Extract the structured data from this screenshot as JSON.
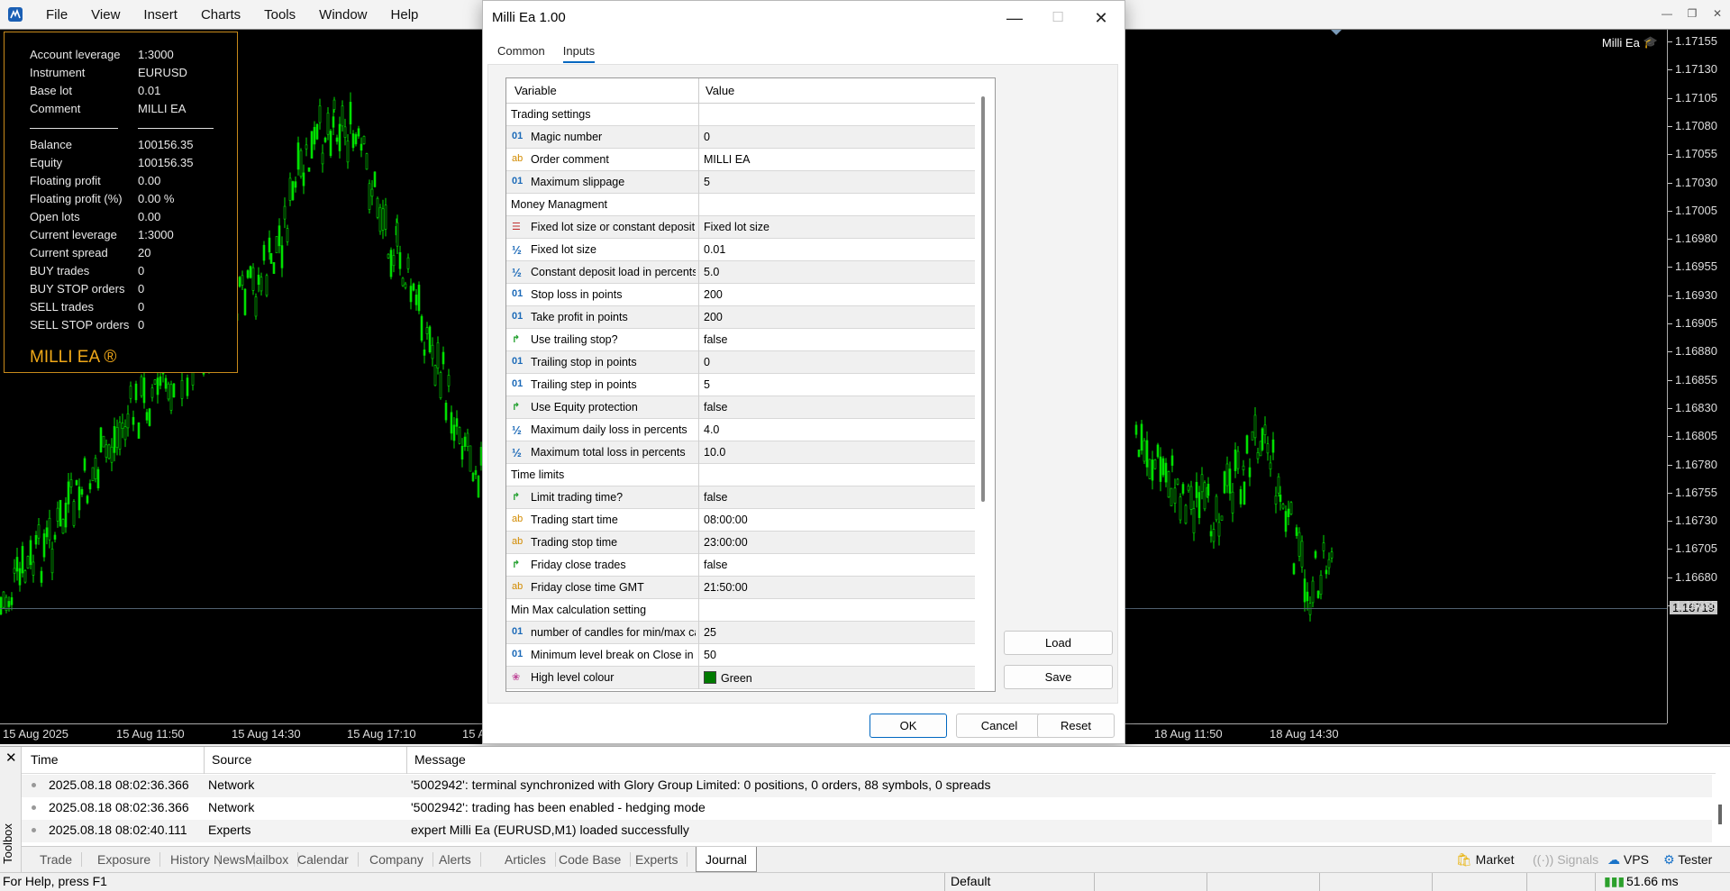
{
  "menubar": {
    "items": [
      "File",
      "View",
      "Insert",
      "Charts",
      "Tools",
      "Window",
      "Help"
    ]
  },
  "chart": {
    "label": "Milli Ea",
    "price_ticks": [
      "1.17155",
      "1.17130",
      "1.17105",
      "1.17080",
      "1.17055",
      "1.17030",
      "1.17005",
      "1.16980",
      "1.16955",
      "1.16930",
      "1.16905",
      "1.16880",
      "1.16855",
      "1.16830",
      "1.16805",
      "1.16780",
      "1.16755",
      "1.16730",
      "1.16705",
      "1.16680",
      "1.16655"
    ],
    "current_price": "1.16719",
    "time_ticks": [
      "15 Aug 2025",
      "15 Aug 11:50",
      "15 Aug 14:30",
      "15 Aug 17:10",
      "15 A",
      "18 Aug 11:50",
      "18 Aug 14:30"
    ],
    "candle_color": "#00e000"
  },
  "infopanel": {
    "rows1": [
      {
        "k": "Account leverage",
        "v": "1:3000"
      },
      {
        "k": "Instrument",
        "v": "EURUSD"
      },
      {
        "k": "Base lot",
        "v": "0.01"
      },
      {
        "k": "Comment",
        "v": "MILLI EA"
      }
    ],
    "rows2": [
      {
        "k": "Balance",
        "v": "100156.35"
      },
      {
        "k": "Equity",
        "v": "100156.35"
      },
      {
        "k": "Floating profit",
        "v": "0.00"
      },
      {
        "k": "Floating profit (%)",
        "v": "0.00 %"
      },
      {
        "k": "Open lots",
        "v": "0.00"
      },
      {
        "k": "Current leverage",
        "v": "1:3000"
      },
      {
        "k": "Current spread",
        "v": "20"
      },
      {
        "k": "BUY trades",
        "v": "0"
      },
      {
        "k": "BUY STOP orders",
        "v": "0"
      },
      {
        "k": "SELL trades",
        "v": "0"
      },
      {
        "k": "SELL STOP orders",
        "v": "0"
      }
    ],
    "brand": "MILLI EA ®"
  },
  "dialog": {
    "title": "Milli Ea 1.00",
    "tabs": [
      "Common",
      "Inputs"
    ],
    "active_tab": "Inputs",
    "col_variable": "Variable",
    "col_value": "Value",
    "rows": [
      {
        "type": "section",
        "var": "Trading settings",
        "val": ""
      },
      {
        "type": "int",
        "var": "Magic number",
        "val": "0"
      },
      {
        "type": "str",
        "var": "Order comment",
        "val": "MILLI EA"
      },
      {
        "type": "int",
        "var": "Maximum slippage",
        "val": "5"
      },
      {
        "type": "section",
        "var": "Money Managment",
        "val": ""
      },
      {
        "type": "enum",
        "var": "Fixed lot size or constant deposit load?",
        "val": "Fixed lot size"
      },
      {
        "type": "dbl",
        "var": "Fixed lot size",
        "val": "0.01"
      },
      {
        "type": "dbl",
        "var": "Constant deposit load in percents",
        "val": "5.0"
      },
      {
        "type": "int",
        "var": "Stop loss in points",
        "val": "200"
      },
      {
        "type": "int",
        "var": "Take profit in points",
        "val": "200"
      },
      {
        "type": "bool",
        "var": "Use trailing stop?",
        "val": "false"
      },
      {
        "type": "int",
        "var": "Trailing stop in points",
        "val": "0"
      },
      {
        "type": "int",
        "var": "Trailing step in points",
        "val": "5"
      },
      {
        "type": "bool",
        "var": "Use Equity protection",
        "val": "false"
      },
      {
        "type": "dbl",
        "var": "Maximum daily loss in percents",
        "val": "4.0"
      },
      {
        "type": "dbl",
        "var": "Maximum total loss in percents",
        "val": "10.0"
      },
      {
        "type": "section",
        "var": "Time limits",
        "val": ""
      },
      {
        "type": "bool",
        "var": "Limit trading time?",
        "val": "false"
      },
      {
        "type": "str",
        "var": "Trading start time",
        "val": "08:00:00"
      },
      {
        "type": "str",
        "var": "Trading stop time",
        "val": "23:00:00"
      },
      {
        "type": "bool",
        "var": "Friday close trades",
        "val": "false"
      },
      {
        "type": "str",
        "var": "Friday close time GMT",
        "val": "21:50:00"
      },
      {
        "type": "section",
        "var": "Min Max calculation setting",
        "val": ""
      },
      {
        "type": "int",
        "var": "number of candles for min/max calcu...",
        "val": "25"
      },
      {
        "type": "int",
        "var": "Minimum level break on Close in points",
        "val": "50"
      },
      {
        "type": "col",
        "var": "High level colour",
        "val": "Green"
      }
    ],
    "icons": {
      "int": "01",
      "str": "ab",
      "dbl": "½",
      "bool": "↱",
      "enum": "☰",
      "col": "❀"
    },
    "buttons": {
      "load": "Load",
      "save": "Save",
      "ok": "OK",
      "cancel": "Cancel",
      "reset": "Reset"
    }
  },
  "toolbox": {
    "side_label": "Toolbox",
    "headers": {
      "time": "Time",
      "source": "Source",
      "message": "Message"
    },
    "log": [
      {
        "time": "2025.08.18 08:02:36.366",
        "source": "Network",
        "message": "'5002942': terminal synchronized with Glory Group Limited: 0 positions, 0 orders, 88 symbols, 0 spreads"
      },
      {
        "time": "2025.08.18 08:02:36.366",
        "source": "Network",
        "message": "'5002942': trading has been enabled - hedging mode"
      },
      {
        "time": "2025.08.18 08:02:40.111",
        "source": "Experts",
        "message": "expert Milli Ea (EURUSD,M1) loaded successfully"
      }
    ],
    "tabs": [
      "Trade",
      "Exposure",
      "History",
      "News",
      "Mailbox",
      "Calendar",
      "Company",
      "Alerts",
      "Articles",
      "Code Base",
      "Experts",
      "Journal"
    ],
    "active_tab": "Journal",
    "right": {
      "market": "Market",
      "signals": "Signals",
      "vps": "VPS",
      "tester": "Tester"
    }
  },
  "statusbar": {
    "help": "For Help, press F1",
    "profile": "Default",
    "ping": "51.66 ms"
  }
}
